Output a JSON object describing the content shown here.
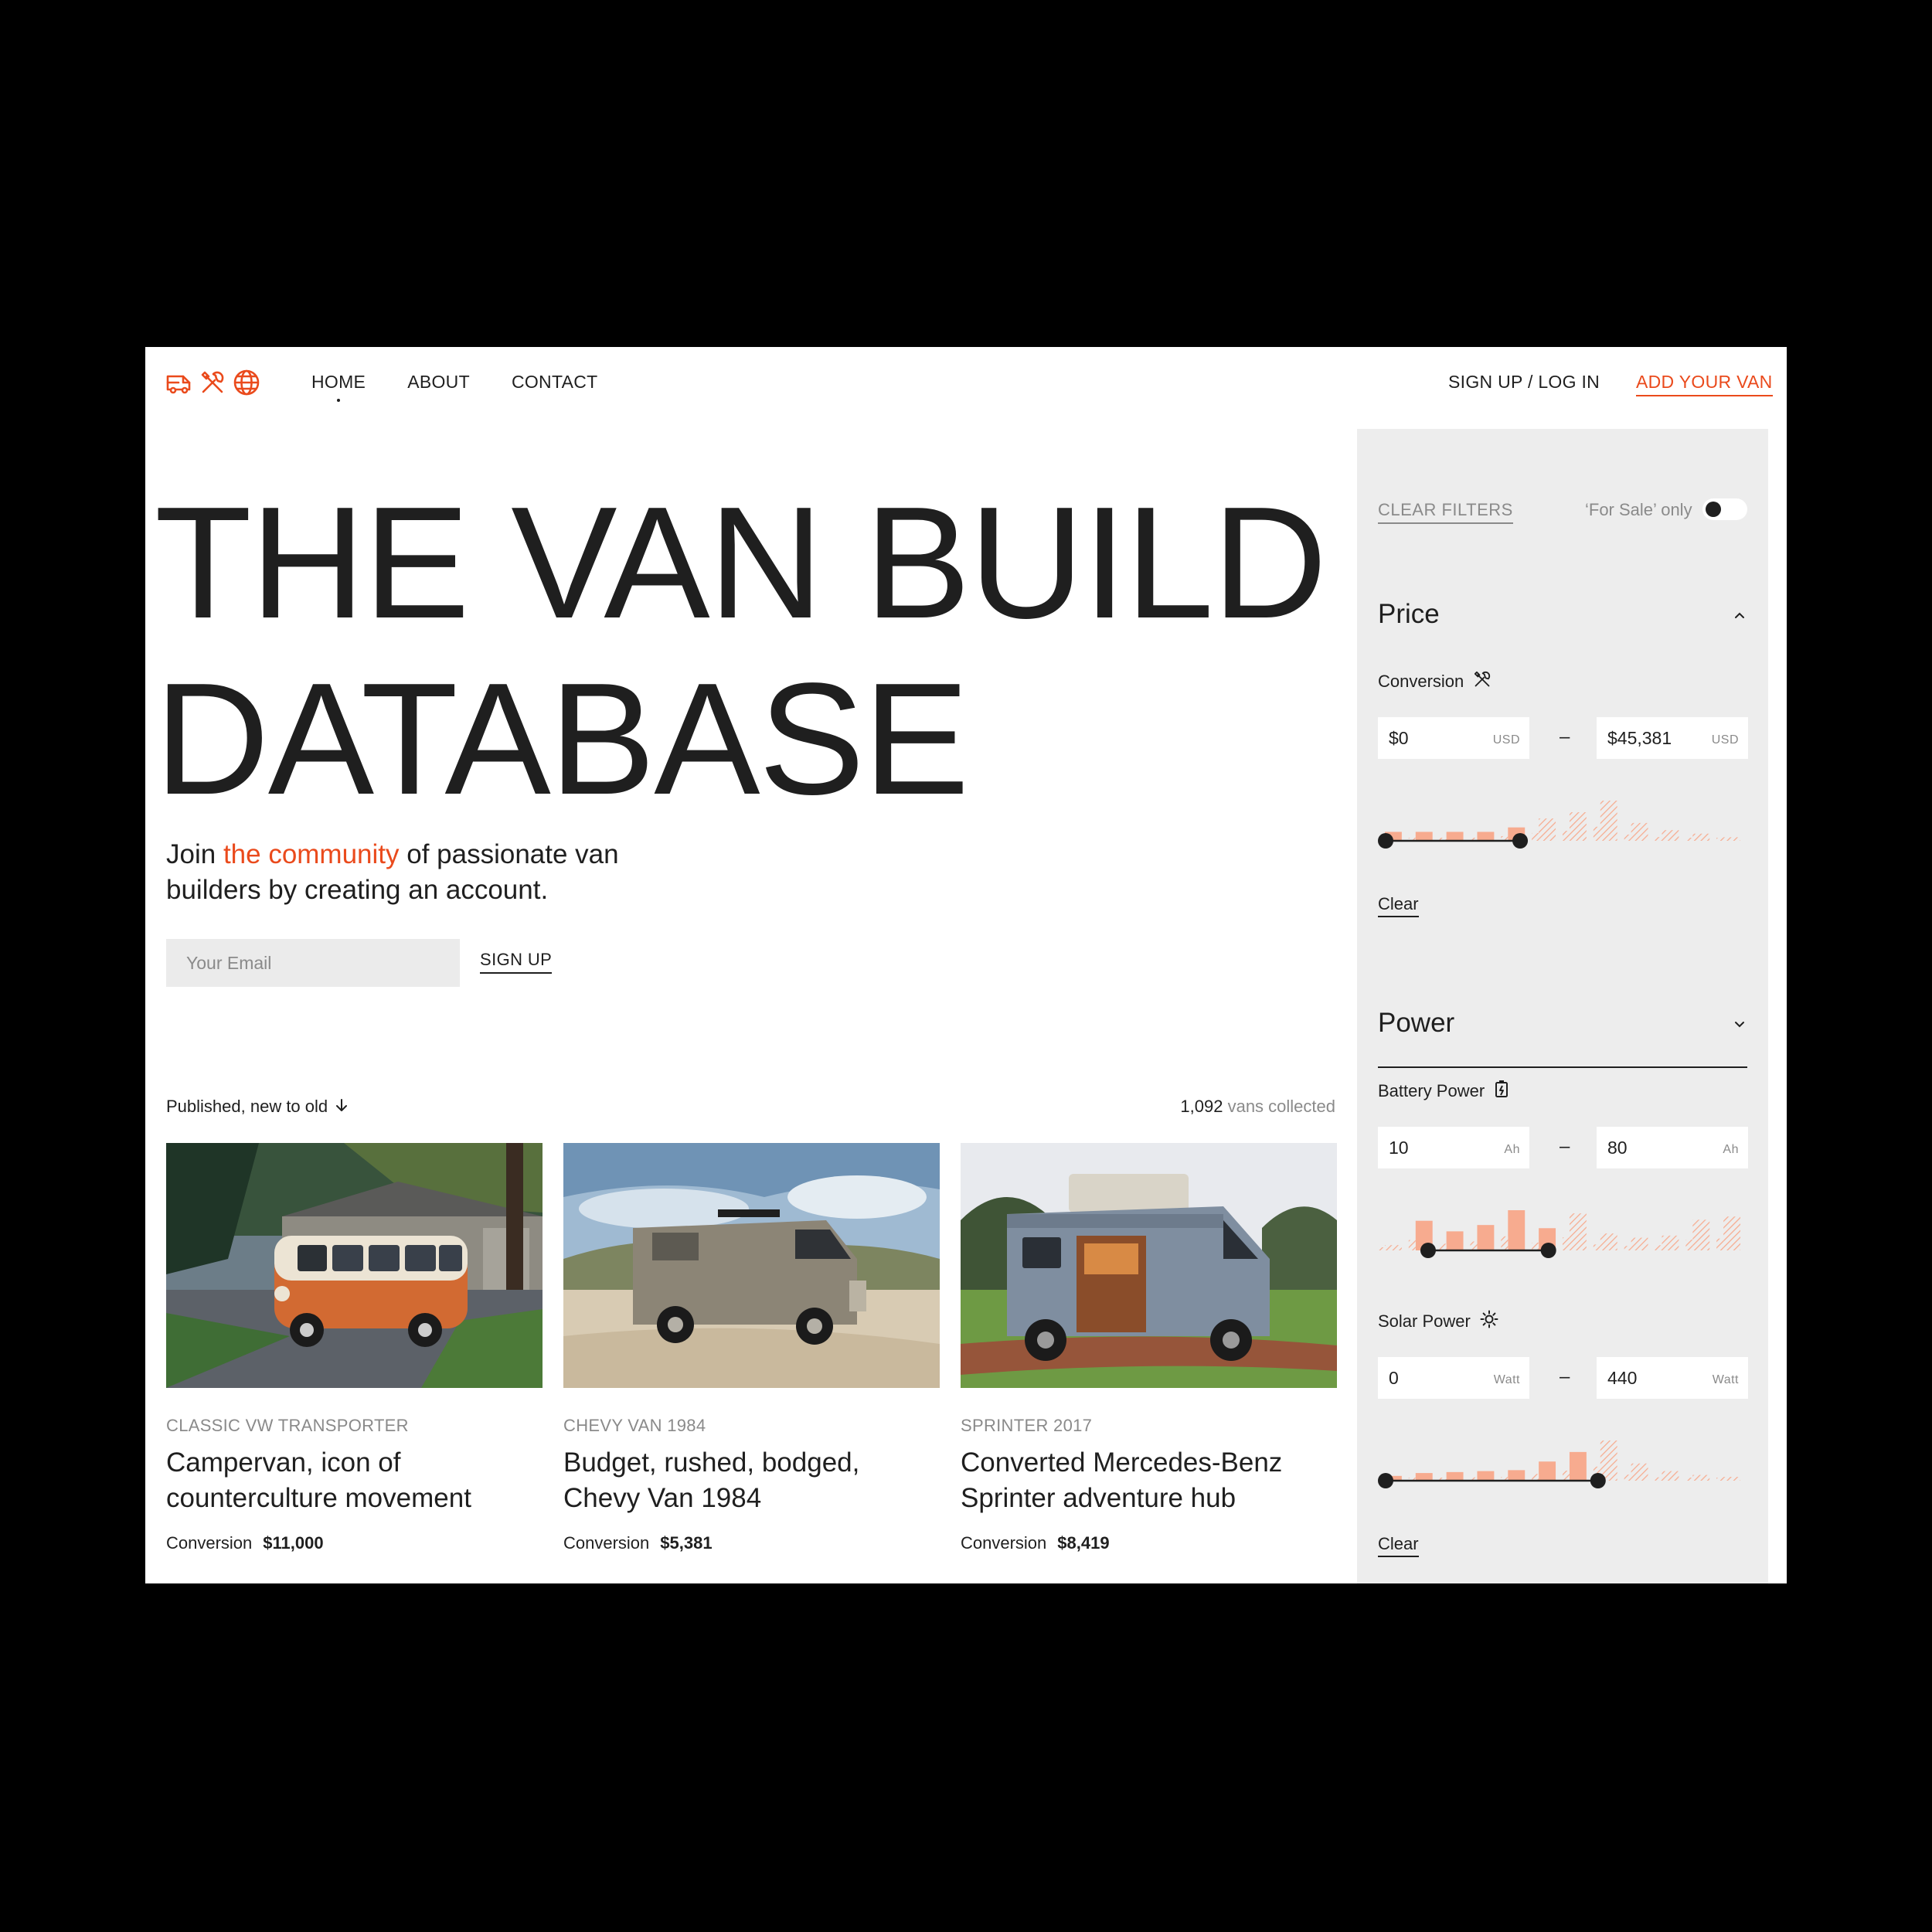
{
  "brand": {
    "accent": "#ea4a1c",
    "icons": [
      "van-icon",
      "tools-icon",
      "globe-icon"
    ]
  },
  "nav": {
    "home": "HOME",
    "about": "ABOUT",
    "contact": "CONTACT",
    "signup_login": "SIGN UP / LOG IN",
    "add_van": "ADD YOUR VAN"
  },
  "hero": {
    "title_line1": "THE VAN BUILD",
    "title_line2": "DATABASE",
    "tagline_pre": "Join ",
    "tagline_link": "the community",
    "tagline_post": " of passionate van builders by creating an account.",
    "email_placeholder": "Your Email",
    "signup": "SIGN UP"
  },
  "list": {
    "sort_label": "Published, new to old",
    "count_number": "1,092",
    "count_suffix": " vans collected",
    "cards": [
      {
        "category": "CLASSIC VW TRANSPORTER",
        "title": "Campervan, icon of counterculture movement",
        "price_label": "Conversion",
        "price": "$11,000"
      },
      {
        "category": "CHEVY VAN 1984",
        "title": "Budget, rushed, bodged, Chevy Van 1984",
        "price_label": "Conversion",
        "price": "$5,381"
      },
      {
        "category": "SPRINTER 2017",
        "title": "Converted Mercedes-Benz Sprinter adventure hub",
        "price_label": "Conversion",
        "price": "$8,419"
      }
    ]
  },
  "filters": {
    "clear_filters": "CLEAR FILTERS",
    "for_sale_label": "‘For Sale’ only",
    "for_sale_on": false,
    "price": {
      "title": "Price",
      "label": "Conversion",
      "min": "$0",
      "max": "$45,381",
      "unit": "USD",
      "clear": "Clear",
      "selected_range_fraction": [
        0,
        0.38
      ],
      "histogram": [
        1,
        1,
        1,
        1,
        1.5,
        2.5,
        3.2,
        4.5,
        2,
        1.2,
        0.8,
        0.4
      ]
    },
    "power": {
      "title": "Power",
      "battery": {
        "label": "Battery Power",
        "min": "10",
        "max": "80",
        "unit": "Ah",
        "selected_range_fraction": [
          0.12,
          0.46
        ],
        "histogram": [
          0.5,
          2.8,
          1.8,
          2.4,
          3.8,
          2.1,
          3.5,
          1.6,
          1.2,
          1.4,
          2.9,
          3.2
        ]
      },
      "solar": {
        "label": "Solar Power",
        "min": "0",
        "max": "440",
        "unit": "Watt",
        "clear": "Clear",
        "selected_range_fraction": [
          0,
          0.6
        ],
        "histogram": [
          0.5,
          0.8,
          0.9,
          1,
          1.1,
          2,
          3,
          4.2,
          1.8,
          1,
          0.6,
          0.4
        ]
      }
    }
  }
}
